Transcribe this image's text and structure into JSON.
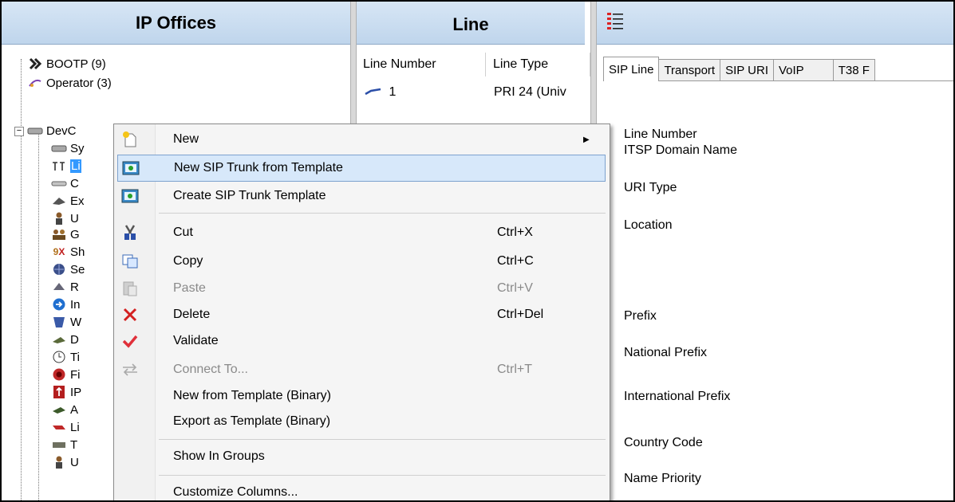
{
  "panels": {
    "left_title": "IP Offices",
    "middle_title": "Line",
    "right_icon": "list-icon"
  },
  "tree": {
    "items": [
      {
        "label": "BOOTP (9)",
        "icon": "bootp-icon"
      },
      {
        "label": "Operator (3)",
        "icon": "operator-icon"
      },
      {
        "label": "DevC",
        "icon": "device-icon"
      },
      {
        "label": "Sy",
        "icon": "system-icon"
      },
      {
        "label": "Li",
        "icon": "line-icon"
      },
      {
        "label": "C",
        "icon": "control-unit-icon"
      },
      {
        "label": "Ex",
        "icon": "extension-icon"
      },
      {
        "label": "U",
        "icon": "user-icon"
      },
      {
        "label": "G",
        "icon": "group-icon"
      },
      {
        "label": "Sh",
        "icon": "short-code-icon"
      },
      {
        "label": "Se",
        "icon": "service-icon"
      },
      {
        "label": "R",
        "icon": "ras-icon"
      },
      {
        "label": "In",
        "icon": "incoming-call-route-icon"
      },
      {
        "label": "W",
        "icon": "wan-port-icon"
      },
      {
        "label": "D",
        "icon": "directory-icon"
      },
      {
        "label": "Ti",
        "icon": "time-profile-icon"
      },
      {
        "label": "Fi",
        "icon": "firewall-profile-icon"
      },
      {
        "label": "IP",
        "icon": "ip-route-icon"
      },
      {
        "label": "A",
        "icon": "account-code-icon"
      },
      {
        "label": "Li",
        "icon": "license-icon"
      },
      {
        "label": "T",
        "icon": "tunnel-icon"
      },
      {
        "label": "U",
        "icon": "user-rights-icon"
      }
    ]
  },
  "line_list": {
    "columns": [
      "Line Number",
      "Line Type"
    ],
    "rows": [
      {
        "number": "1",
        "type": "PRI 24 (Univ"
      }
    ]
  },
  "right_panel": {
    "tabs": [
      "SIP Line",
      "Transport",
      "SIP URI",
      "VoIP",
      "T38 F"
    ],
    "active_tab": "SIP Line",
    "fields": [
      "Line Number",
      "ITSP Domain Name",
      "URI Type",
      "Location",
      "Prefix",
      "National Prefix",
      "International Prefix",
      "Country Code",
      "Name Priority"
    ]
  },
  "context_menu": {
    "items": [
      {
        "label": "New",
        "shortcut": "",
        "icon": "new-icon",
        "submenu": true
      },
      {
        "label": "New SIP Trunk from Template",
        "shortcut": "",
        "icon": "sip-trunk-icon",
        "highlighted": true
      },
      {
        "label": "Create SIP Trunk Template",
        "shortcut": "",
        "icon": "sip-template-icon"
      },
      {
        "label": "Cut",
        "shortcut": "Ctrl+X",
        "icon": "cut-icon"
      },
      {
        "label": "Copy",
        "shortcut": "Ctrl+C",
        "icon": "copy-icon"
      },
      {
        "label": "Paste",
        "shortcut": "Ctrl+V",
        "icon": "paste-icon",
        "disabled": true
      },
      {
        "label": "Delete",
        "shortcut": "Ctrl+Del",
        "icon": "delete-icon"
      },
      {
        "label": "Validate",
        "shortcut": "",
        "icon": "validate-icon"
      },
      {
        "label": "Connect To...",
        "shortcut": "Ctrl+T",
        "icon": "connect-icon",
        "disabled": true
      },
      {
        "label": "New from Template (Binary)",
        "shortcut": "",
        "icon": ""
      },
      {
        "label": "Export as Template (Binary)",
        "shortcut": "",
        "icon": ""
      },
      {
        "label": "Show In Groups",
        "shortcut": "",
        "icon": ""
      },
      {
        "label": "Customize Columns...",
        "shortcut": "",
        "icon": ""
      }
    ]
  },
  "colors": {
    "header_bg": "#c9dcf0",
    "highlight_bg": "#d7e8fa",
    "highlight_border": "#7da2ce",
    "delete_red": "#d42020",
    "validate_red": "#e0303a"
  }
}
